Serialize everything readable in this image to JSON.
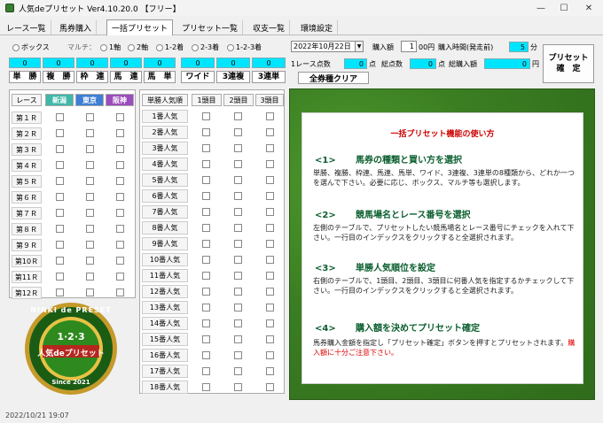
{
  "window": {
    "title": "人気deプリセット Ver4.10.20.0 【フリー】"
  },
  "tabs": [
    "レース一覧",
    "馬券購入",
    "一括プリセット",
    "プリセット一覧",
    "収支一覧",
    "環境設定"
  ],
  "active_tab": 2,
  "options": {
    "box_label": "ボックス",
    "multi_label": "マルチ：",
    "multi": [
      "1軸",
      "2軸",
      "1-2着",
      "2-3着",
      "1-2-3着"
    ]
  },
  "order": {
    "date": "2022年10月22日",
    "purchase_amount_label": "購入額",
    "amount_value": "1",
    "amount_suffix": "00円",
    "time_label": "購入時間(発走前)",
    "time_value": "5",
    "time_unit": "分",
    "preset_button": "プリセット\n確　定",
    "race_points_label": "1レース点数",
    "race_points_value": "0",
    "race_points_unit": "点",
    "total_points_label": "総点数",
    "total_points_value": "0",
    "total_points_unit": "点",
    "total_amount_label": "総購入額",
    "total_amount_value": "0",
    "total_amount_unit": "円",
    "clear_button": "全券種クリア"
  },
  "bet_types": [
    {
      "label": "単　勝",
      "value": "0"
    },
    {
      "label": "複　勝",
      "value": "0"
    },
    {
      "label": "枠　連",
      "value": "0"
    },
    {
      "label": "馬　連",
      "value": "0"
    },
    {
      "label": "馬　単",
      "value": "0"
    },
    {
      "label": "ワイド",
      "value": "0"
    },
    {
      "label": "3連複",
      "value": "0"
    },
    {
      "label": "3連単",
      "value": "0"
    }
  ],
  "race_table": {
    "header": "レース",
    "venues": [
      {
        "name": "新潟",
        "color": "#3fb8a8"
      },
      {
        "name": "東京",
        "color": "#3d7fd6"
      },
      {
        "name": "阪神",
        "color": "#9b4dbd"
      }
    ],
    "races": [
      "第１Ｒ",
      "第２Ｒ",
      "第３Ｒ",
      "第４Ｒ",
      "第５Ｒ",
      "第６Ｒ",
      "第７Ｒ",
      "第８Ｒ",
      "第９Ｒ",
      "第10Ｒ",
      "第11Ｒ",
      "第12Ｒ"
    ]
  },
  "pop_table": {
    "headers": [
      "単勝人気順",
      "1頭目",
      "2頭目",
      "3頭目"
    ],
    "rows": [
      "1番人気",
      "2番人気",
      "3番人気",
      "4番人気",
      "5番人気",
      "6番人気",
      "7番人気",
      "8番人気",
      "9番人気",
      "10番人気",
      "11番人気",
      "12番人気",
      "13番人気",
      "14番人気",
      "15番人気",
      "16番人気",
      "17番人気",
      "18番人気"
    ]
  },
  "logo": {
    "ring_text": "NINKI de PRESET",
    "numbers": "1·2·3",
    "name": "人気deプリセット",
    "since": "Since 2021"
  },
  "help": {
    "title": "一括プリセット機能の使い方",
    "sections": [
      {
        "num": "<1>",
        "heading": "馬券の種類と買い方を選択",
        "body": "単勝、複勝、枠連、馬連、馬単、ワイド、3連複、3連単の8種類から、どれか一つを選んで下さい。必要に応じ、ボックス、マルチ等も選択します。"
      },
      {
        "num": "<2>",
        "heading": "競馬場名とレース番号を選択",
        "body": "左側のテーブルで、プリセットしたい競馬場名とレース番号にチェックを入れて下さい。一行目のインデックスをクリックすると全選択されます。"
      },
      {
        "num": "<3>",
        "heading": "単勝人気順位を設定",
        "body": "右側のテーブルで、1頭目、2頭目、3頭目に何番人気を指定するかチェックして下さい。一行目のインデックスをクリックすると全選択されます。"
      },
      {
        "num": "<4>",
        "heading": "購入額を決めてプリセット確定",
        "body": "馬券購入金額を指定し「プリセット確定」ボタンを押すとプリセットされます。",
        "warning": "購入額に十分ご注意下さい。"
      }
    ]
  },
  "status": {
    "datetime": "2022/10/21 19:07"
  }
}
